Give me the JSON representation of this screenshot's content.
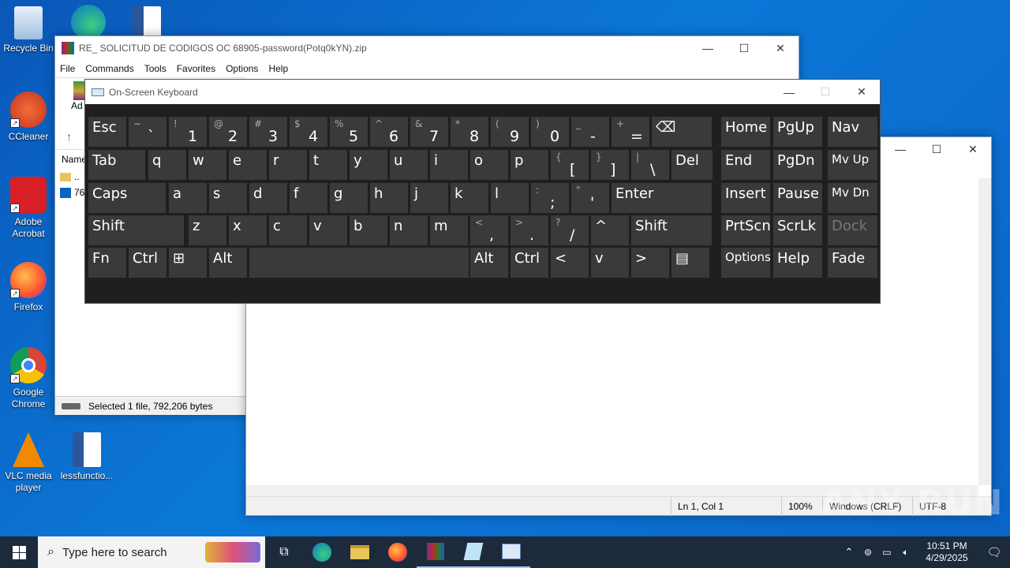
{
  "desktop": {
    "icons": [
      {
        "label": "Recycle Bin"
      },
      {
        "label": "CCleaner"
      },
      {
        "label": "Adobe Acrobat"
      },
      {
        "label": "Firefox"
      },
      {
        "label": "Google Chrome"
      },
      {
        "label": "VLC media player"
      },
      {
        "label": "lessfunctio..."
      }
    ]
  },
  "winrar": {
    "title": "RE_ SOLICITUD DE CODIGOS OC 68905-password(Potq0kYN).zip",
    "menu": [
      "File",
      "Commands",
      "Tools",
      "Favorites",
      "Options",
      "Help"
    ],
    "toolbar_label": "Ad",
    "column_name": "Name",
    "rows": [
      "..",
      "76"
    ],
    "status": "Selected 1 file, 792,206 bytes"
  },
  "notepad": {
    "status": {
      "position": "Ln 1, Col 1",
      "zoom": "100%",
      "eol": "Windows (CRLF)",
      "encoding": "UTF-8"
    }
  },
  "osk": {
    "title": "On-Screen Keyboard",
    "rows": [
      [
        {
          "label": "Esc"
        },
        {
          "sub": "~",
          "main": "`"
        },
        {
          "sub": "!",
          "main": "1"
        },
        {
          "sub": "@",
          "main": "2"
        },
        {
          "sub": "#",
          "main": "3"
        },
        {
          "sub": "$",
          "main": "4"
        },
        {
          "sub": "%",
          "main": "5"
        },
        {
          "sub": "^",
          "main": "6"
        },
        {
          "sub": "&",
          "main": "7"
        },
        {
          "sub": "*",
          "main": "8"
        },
        {
          "sub": "(",
          "main": "9"
        },
        {
          "sub": ")",
          "main": "0"
        },
        {
          "sub": "_",
          "main": "-"
        },
        {
          "sub": "+",
          "main": "="
        },
        {
          "label": "⌫"
        },
        {
          "label": "Home"
        },
        {
          "label": "PgUp"
        },
        {
          "label": "Nav"
        }
      ],
      [
        {
          "label": "Tab"
        },
        {
          "label": "q"
        },
        {
          "label": "w"
        },
        {
          "label": "e"
        },
        {
          "label": "r"
        },
        {
          "label": "t"
        },
        {
          "label": "y"
        },
        {
          "label": "u"
        },
        {
          "label": "i"
        },
        {
          "label": "o"
        },
        {
          "label": "p"
        },
        {
          "sub": "{",
          "main": "["
        },
        {
          "sub": "}",
          "main": "]"
        },
        {
          "sub": "|",
          "main": "\\"
        },
        {
          "label": "Del"
        },
        {
          "label": "End"
        },
        {
          "label": "PgDn"
        },
        {
          "label": "Mv Up"
        }
      ],
      [
        {
          "label": "Caps"
        },
        {
          "label": "a"
        },
        {
          "label": "s"
        },
        {
          "label": "d"
        },
        {
          "label": "f"
        },
        {
          "label": "g"
        },
        {
          "label": "h"
        },
        {
          "label": "j"
        },
        {
          "label": "k"
        },
        {
          "label": "l"
        },
        {
          "sub": ":",
          "main": ";"
        },
        {
          "sub": "\"",
          "main": "'"
        },
        {
          "label": "Enter"
        },
        {
          "label": "Insert"
        },
        {
          "label": "Pause"
        },
        {
          "label": "Mv Dn"
        }
      ],
      [
        {
          "label": "Shift"
        },
        {
          "label": "z"
        },
        {
          "label": "x"
        },
        {
          "label": "c"
        },
        {
          "label": "v"
        },
        {
          "label": "b"
        },
        {
          "label": "n"
        },
        {
          "label": "m"
        },
        {
          "sub": "<",
          "main": ","
        },
        {
          "sub": ">",
          "main": "."
        },
        {
          "sub": "?",
          "main": "/"
        },
        {
          "label": "^"
        },
        {
          "label": "Shift"
        },
        {
          "label": "PrtScn"
        },
        {
          "label": "ScrLk"
        },
        {
          "label": "Dock"
        }
      ],
      [
        {
          "label": "Fn"
        },
        {
          "label": "Ctrl"
        },
        {
          "label": "⊞"
        },
        {
          "label": "Alt"
        },
        {
          "label": ""
        },
        {
          "label": "Alt"
        },
        {
          "label": "Ctrl"
        },
        {
          "label": "<"
        },
        {
          "label": "v"
        },
        {
          "label": ">"
        },
        {
          "label": "▤"
        },
        {
          "label": "Options"
        },
        {
          "label": "Help"
        },
        {
          "label": "Fade"
        }
      ]
    ]
  },
  "taskbar": {
    "search_placeholder": "Type here to search",
    "time": "10:51 PM",
    "date": "4/29/2025"
  },
  "watermark": "ANY RUN"
}
